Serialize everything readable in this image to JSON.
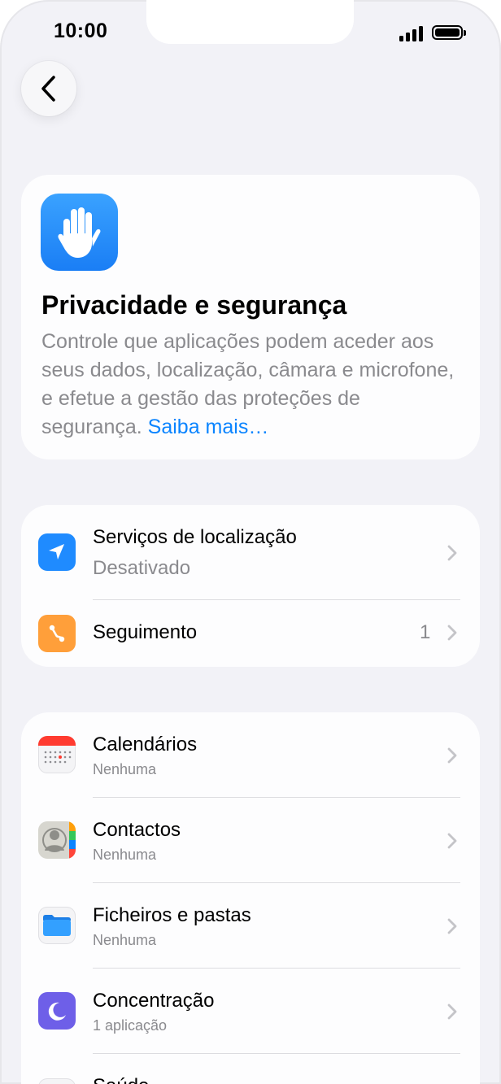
{
  "status_bar": {
    "time": "10:00"
  },
  "header": {
    "title": "Privacidade e segurança",
    "description": "Controle que aplicações podem aceder aos seus dados, localização, câmara e microfone, e efetue a gestão das proteções de segurança.",
    "learn_more": "Saiba mais…"
  },
  "group1": [
    {
      "title": "Serviços de localização",
      "subtitle": "Desativado",
      "icon": "location-arrow-icon",
      "color": "#1f8bff"
    },
    {
      "title": "Seguimento",
      "count": "1",
      "icon": "tracking-icon",
      "color": "#ff9f3a"
    }
  ],
  "group2": [
    {
      "title": "Calendários",
      "subtitle": "Nenhuma",
      "icon": "calendar-icon"
    },
    {
      "title": "Contactos",
      "subtitle": "Nenhuma",
      "icon": "contacts-icon"
    },
    {
      "title": "Ficheiros e pastas",
      "subtitle": "Nenhuma",
      "icon": "folder-icon"
    },
    {
      "title": "Concentração",
      "subtitle": "1 aplicação",
      "icon": "moon-icon",
      "color": "#6e5fe8"
    },
    {
      "title": "Saúde",
      "icon": "health-icon"
    }
  ]
}
